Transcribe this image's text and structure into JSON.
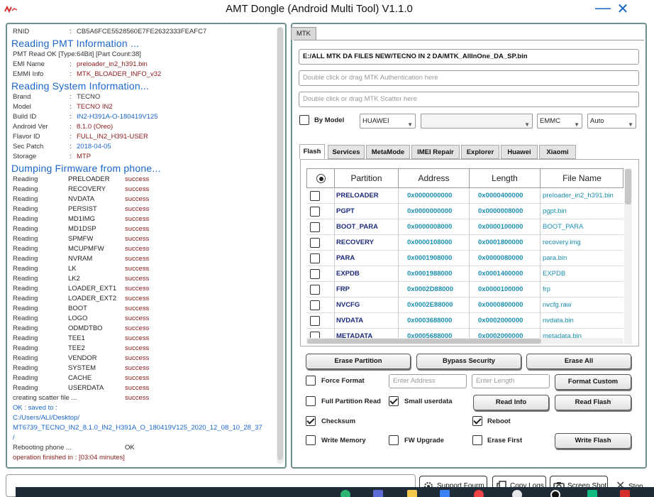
{
  "window": {
    "title": "AMT Dongle (Android Multi Tool) V1.1.0",
    "minimize_symbol": "—",
    "close_symbol": "✕"
  },
  "log": {
    "rnid_label": "RNID",
    "rnid_value": "CB5A6FCE5528560E7FE2632333FEAFC7",
    "pmt_header": "Reading PMT Information ...",
    "pmt_read_text": "PMT Read OK [Type:64Bit] [Part Count:38]",
    "emi_name_label": "EMI Name",
    "emi_name_value": "preloader_in2_h391.bin",
    "emmi_info_label": "EMMI Info",
    "emmi_info_value": "MTK_BLOADER_INFO_v32",
    "system_header": "Reading System Information...",
    "brand_label": "Brand",
    "brand_value": "TECNO",
    "model_label": "Model",
    "model_value": "TECNO IN2",
    "build_label": "Build ID",
    "build_value": "IN2-H391A-O-180419V125",
    "android_label": "Android Ver",
    "android_value": "8.1.0 (Oreo)",
    "flavor_label": "Flavor ID",
    "flavor_value": "FULL_IN2_H391-USER",
    "secpatch_label": "Sec Patch",
    "secpatch_value": "2018-04-05",
    "storage_label": "Storage",
    "storage_value": "MTP",
    "separator": ":",
    "dump_header": "Dumping Firmware from phone...",
    "reading_word": "Reading",
    "success_word": "success",
    "reading_items": [
      "PRELOADER",
      "RECOVERY",
      "NVDATA",
      "PERSIST",
      "MD1IMG",
      "MD1DSP",
      "SPMFW",
      "MCUPMFW",
      "NVRAM",
      "LK",
      "LK2",
      "LOADER_EXT1",
      "LOADER_EXT2",
      "BOOT",
      "LOGO",
      "ODMDTBO",
      "TEE1",
      "TEE2",
      "VENDOR",
      "SYSTEM",
      "CACHE",
      "USERDATA"
    ],
    "scatter_text": "creating scatter file ...",
    "saved_text": "OK : saved to :",
    "saved_path_1": "C:/Users/ALI/Desktop/",
    "saved_path_2": "MT6739_TECNO_IN2_8.1.0_IN2_H391A_O_180419V125_2020_12_08_10_28_37",
    "saved_path_3": "/",
    "reboot_text": "Rebooting phone ...",
    "reboot_status": "OK",
    "finished_text": "operation finished in : [03:04 minutes]"
  },
  "mtk": {
    "tab_label": "MTK",
    "da_file": "E:/ALL  MTK DA FILES NEW/TECNO IN 2 DA/MTK_AllInOne_DA_SP.bin",
    "auth_placeholder": "Double click or drag MTK Authentication here",
    "scatter_placeholder": "Double click or drag MTK Scatter here",
    "by_model_label": "By Model",
    "brand_combo": "HUAWEI",
    "model_combo": "",
    "storage_combo": "EMMC",
    "mode_combo": "Auto",
    "subtabs": [
      "Flash",
      "Services",
      "MetaMode",
      "IMEI Repair",
      "Explorer",
      "Huawei",
      "Xiaomi"
    ],
    "columns": [
      "Partition",
      "Address",
      "Length",
      "File Name"
    ],
    "partitions": [
      {
        "name": "PRELOADER",
        "address": "0x0000000000",
        "length": "0x0000400000",
        "file": "preloader_in2_h391.bin"
      },
      {
        "name": "PGPT",
        "address": "0x0000000000",
        "length": "0x0000008000",
        "file": "pgpt.bin"
      },
      {
        "name": "BOOT_PARA",
        "address": "0x0000008000",
        "length": "0x0000100000",
        "file": "BOOT_PARA"
      },
      {
        "name": "RECOVERY",
        "address": "0x0000108000",
        "length": "0x0001800000",
        "file": "recovery.img"
      },
      {
        "name": "PARA",
        "address": "0x0001908000",
        "length": "0x0000080000",
        "file": "para.bin"
      },
      {
        "name": "EXPDB",
        "address": "0x0001988000",
        "length": "0x0001400000",
        "file": "EXPDB"
      },
      {
        "name": "FRP",
        "address": "0x0002D88000",
        "length": "0x0000100000",
        "file": "frp"
      },
      {
        "name": "NVCFG",
        "address": "0x0002E88000",
        "length": "0x0000800000",
        "file": "nvcfg.raw"
      },
      {
        "name": "NVDATA",
        "address": "0x0003688000",
        "length": "0x0002000000",
        "file": "nvdata.bin"
      },
      {
        "name": "METADATA",
        "address": "0x0005688000",
        "length": "0x0002000000",
        "file": "metadata.bin"
      }
    ],
    "buttons": {
      "erase_partition": "Erase Partition",
      "bypass_security": "Bypass Security",
      "erase_all": "Erase All",
      "format_custom": "Format Custom",
      "read_info": "Read Info",
      "read_flash": "Read Flash",
      "write_flash": "Write Flash"
    },
    "options": {
      "force_format": "Force Format",
      "full_partition_read": "Full Partition Read",
      "small_userdata": "Small userdata",
      "checksum": "Checksum",
      "reboot": "Reboot",
      "write_memory": "Write Memory",
      "fw_upgrade": "FW Upgrade",
      "erase_first": "Erase First"
    },
    "address_placeholder": "Enter Address",
    "length_placeholder": "Enter Length"
  },
  "bottom": {
    "support_forum": "Support Fourm",
    "copy_logs": "Copy Logs",
    "screen_shot": "Screen Shot",
    "stop": "Stop"
  },
  "colors": {
    "accent_blue": "#1a66cc",
    "close_blue": "#1565c0",
    "success_red": "#8b1a1a",
    "partition_navy": "#1b2a7a",
    "value_teal": "#1a8fb0"
  }
}
